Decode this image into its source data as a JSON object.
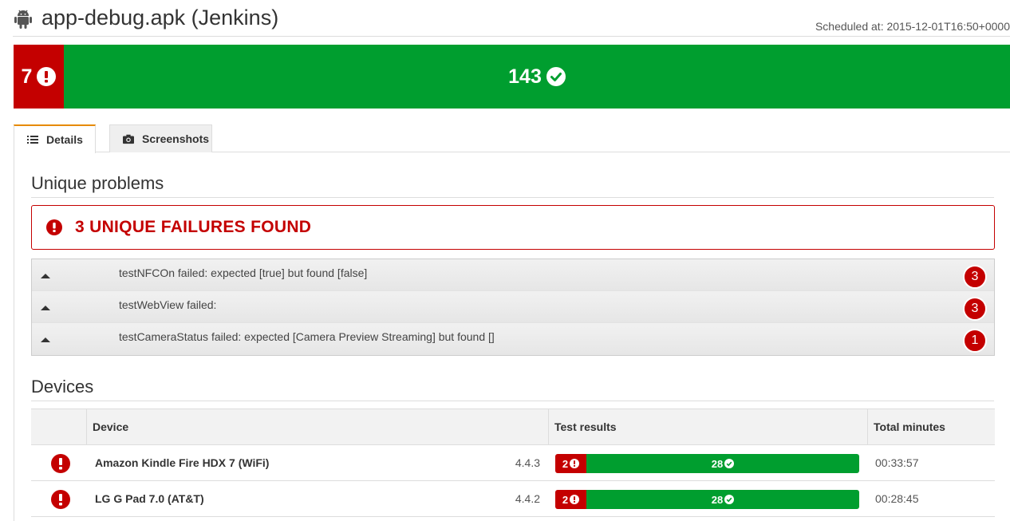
{
  "header": {
    "title": "app-debug.apk (Jenkins)",
    "scheduled": "Scheduled at: 2015-12-01T16:50+0000",
    "app_icon": "android-icon"
  },
  "summary": {
    "failed": "7",
    "passed": "143"
  },
  "tabs": [
    {
      "label": "Details",
      "icon": "list-icon",
      "active": true
    },
    {
      "label": "Screenshots",
      "icon": "camera-icon",
      "active": false
    }
  ],
  "unique_problems": {
    "title": "Unique problems",
    "banner": "3 UNIQUE FAILURES FOUND",
    "items": [
      {
        "text": "testNFCOn failed: expected [true] but found [false]",
        "count": "3"
      },
      {
        "text": "testWebView failed:",
        "count": "3"
      },
      {
        "text": "testCameraStatus failed: expected [Camera Preview Streaming] but found []",
        "count": "1"
      }
    ]
  },
  "devices": {
    "title": "Devices",
    "columns": {
      "device": "Device",
      "results": "Test results",
      "minutes": "Total minutes"
    },
    "rows": [
      {
        "name": "Amazon Kindle Fire HDX 7 (WiFi)",
        "version": "4.4.3",
        "failed": "2",
        "passed": "28",
        "minutes": "00:33:57"
      },
      {
        "name": "LG G Pad 7.0 (AT&T)",
        "version": "4.4.2",
        "failed": "2",
        "passed": "28",
        "minutes": "00:28:45"
      }
    ]
  },
  "colors": {
    "fail": "#c40000",
    "pass": "#009e2f",
    "tab_accent": "#e68a00"
  }
}
